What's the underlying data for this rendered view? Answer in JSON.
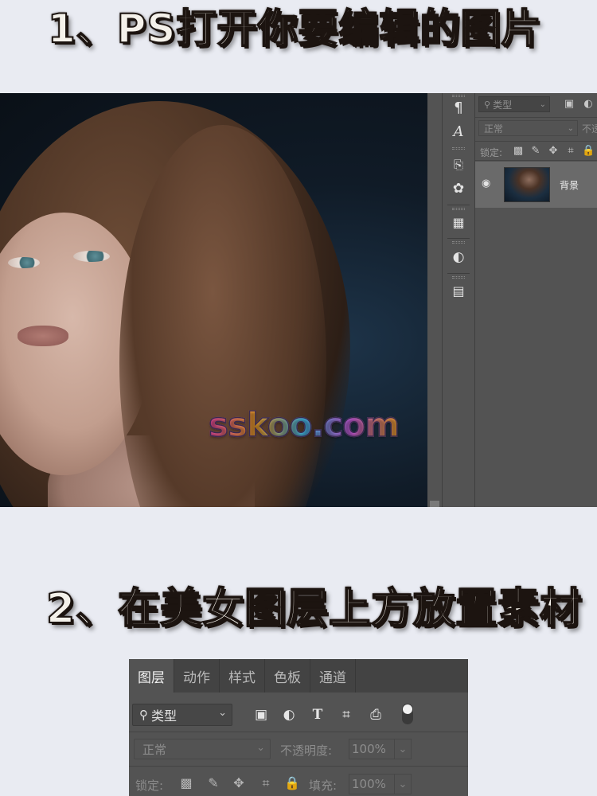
{
  "step1": {
    "title": "1、PS打开你要编辑的图片"
  },
  "step2": {
    "title": "2、在美女图层上方放置素材"
  },
  "screenshot1": {
    "watermark": "sskoo.com",
    "side_tools": [
      "paragraph-icon",
      "character-icon",
      "history-icon",
      "swatches-icon",
      "3d-icon",
      "adjustments-icon",
      "gradient-icon"
    ],
    "layers_panel": {
      "kind_filter": "类型",
      "blend_mode": "正常",
      "opacity_label_partial": "不透",
      "lock_label": "锁定:",
      "layer_name": "背景"
    }
  },
  "screenshot2": {
    "tabs": [
      "图层",
      "动作",
      "样式",
      "色板",
      "通道"
    ],
    "active_tab": "图层",
    "kind_filter": "类型",
    "blend_mode": "正常",
    "opacity_label": "不透明度:",
    "opacity_value": "100%",
    "lock_label": "锁定:",
    "fill_label": "填充:",
    "fill_value": "100%"
  },
  "colors": {
    "background": "#e9ebf2",
    "ps_panel": "#535353",
    "ps_tabbar": "#434343"
  }
}
